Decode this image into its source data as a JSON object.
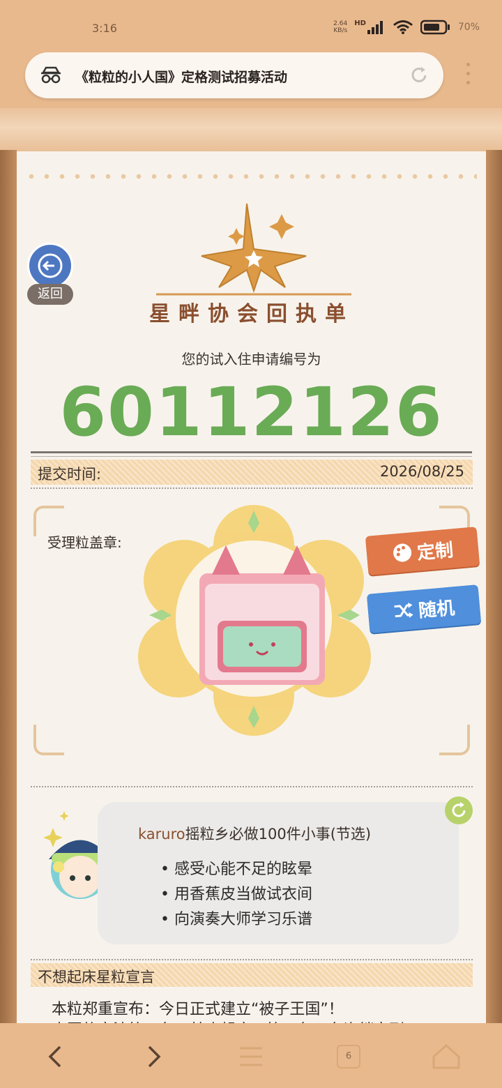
{
  "status_bar": {
    "time": "3:16",
    "net_speed_value": "2.64",
    "net_speed_unit": "KB/s",
    "network": "HD",
    "battery": "70%",
    "icons": [
      "signal-icon",
      "wifi-icon",
      "battery-icon"
    ]
  },
  "browser": {
    "page_title": "《粒粒的小人国》定格测试招募活动",
    "icons": [
      "incognito-icon",
      "reload-icon",
      "menu-icon"
    ]
  },
  "page": {
    "back_label": "返回",
    "logo_title": "星畔协会回执单",
    "intro_text": "您的试入住申请编号为",
    "application_number": "60112126",
    "submit_time_label": "提交时间:",
    "submit_time_value": "2026/08/25",
    "stamp_label": "受理粒盖章:",
    "custom_button": "定制",
    "random_button": "随机"
  },
  "bubble": {
    "name": "karuro",
    "title_rest": "摇粒乡必做100件小事(节选)",
    "items": [
      "感受心能不足的眩晕",
      "用香蕉皮当做试衣间",
      "向演奏大师学习乐谱"
    ]
  },
  "declaration": {
    "title": "不想起床星粒宣言",
    "line1": "本粒郑重宣布：今日正式建立“被子王国”！",
    "line2": "本国的宪法第一条：禁止起床。第二条：允许躺宅到"
  },
  "nav_bar": {
    "tab_count": "6",
    "icons": [
      "back-icon",
      "forward-icon",
      "menu-icon",
      "tabs-icon",
      "home-icon"
    ]
  },
  "colors": {
    "accent_green": "#6aab55",
    "brand_brown": "#8a4f2f",
    "custom_orange": "#e0784a",
    "random_blue": "#4f8fdc",
    "background": "#e9b98e"
  }
}
